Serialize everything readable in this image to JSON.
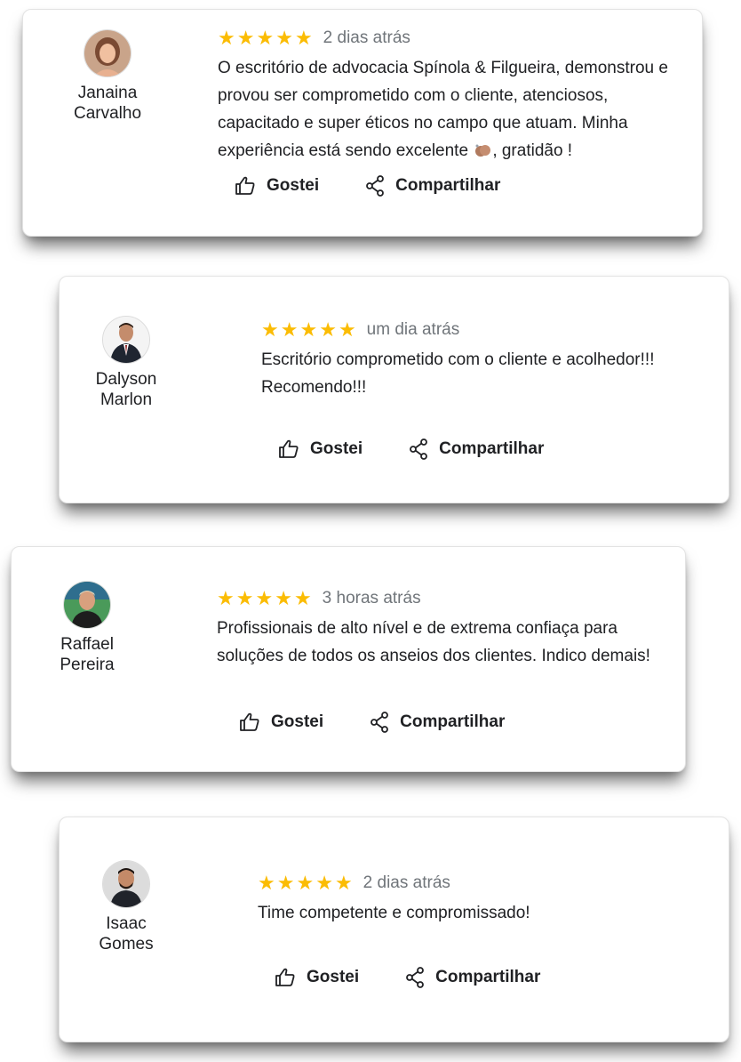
{
  "actions": {
    "like_label": "Gostei",
    "share_label": "Compartilhar"
  },
  "colors": {
    "star": "#fbbc04",
    "time": "#70757a"
  },
  "reviews": [
    {
      "name_line1": "Janaina",
      "name_line2": "Carvalho",
      "rating": 5,
      "time": "2 dias atrás",
      "text_before_emoji": "O escritório de advocacia Spínola & Filgueira, demonstrou e provou ser comprometido com o cliente, atenciosos, capacitado e super éticos no campo que atuam. Minha experiência está sendo excelente ",
      "text_after_emoji": ", gratidão !",
      "emoji_icon": "clapping-hands-icon"
    },
    {
      "name_line1": "Dalyson",
      "name_line2": "Marlon",
      "rating": 5,
      "time": "um dia atrás",
      "text": "Escritório comprometido com o cliente e acolhedor!!! Recomendo!!!"
    },
    {
      "name_line1": "Raffael",
      "name_line2": "Pereira",
      "rating": 5,
      "time": "3 horas atrás",
      "text": "Profissionais de alto nível e de extrema confiaça para soluções de todos os anseios dos clientes. Indico demais!"
    },
    {
      "name_line1": "Isaac",
      "name_line2": "Gomes",
      "rating": 5,
      "time": "2 dias atrás",
      "text": "Time competente e compromissado!"
    }
  ]
}
